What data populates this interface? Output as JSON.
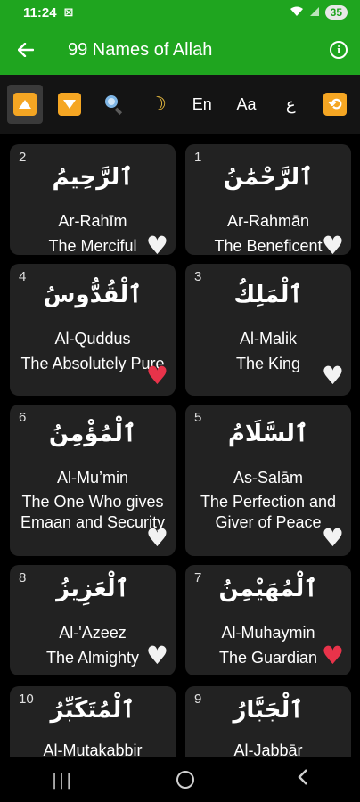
{
  "status": {
    "time": "11:24",
    "icons": "⊠",
    "battery": "35"
  },
  "appbar": {
    "title": "99 Names of Allah"
  },
  "toolbar": {
    "lang_label": "En",
    "font_label": "Aa",
    "arabic_label": "ع"
  },
  "cards": [
    {
      "number": "2",
      "arabic": "ٱلرَّحِيمُ",
      "translit": "Ar-Rahīm",
      "meaning": "The Merciful",
      "favorite": false
    },
    {
      "number": "1",
      "arabic": "ٱلرَّحْمَٰنُ",
      "translit": "Ar-Rahmān",
      "meaning": "The Beneficent",
      "favorite": false
    },
    {
      "number": "4",
      "arabic": "ٱلْقُدُّوسُ",
      "translit": "Al-Quddus",
      "meaning": "The Absolutely Pure",
      "favorite": true
    },
    {
      "number": "3",
      "arabic": "ٱلْمَلِكُ",
      "translit": "Al-Malik",
      "meaning": "The King",
      "favorite": false
    },
    {
      "number": "6",
      "arabic": "ٱلْمُؤْمِنُ",
      "translit": "Al-Mu’min",
      "meaning": "The One Who gives Emaan and Security",
      "favorite": false
    },
    {
      "number": "5",
      "arabic": "ٱلسَّلَامُ",
      "translit": "As-Salām",
      "meaning": "The Perfection and Giver of Peace",
      "favorite": false
    },
    {
      "number": "8",
      "arabic": "ٱلْعَزِيزُ",
      "translit": "Al-'Azeez",
      "meaning": "The Almighty",
      "favorite": false
    },
    {
      "number": "7",
      "arabic": "ٱلْمُهَيْمِنُ",
      "translit": "Al-Muhaymin",
      "meaning": "The Guardian",
      "favorite": true
    },
    {
      "number": "10",
      "arabic": "ٱلْمُتَكَبِّرُ",
      "translit": "Al-Mutakabbir",
      "meaning": "",
      "favorite": false
    },
    {
      "number": "9",
      "arabic": "ٱلْجَبَّارُ",
      "translit": "Al-Jabbār",
      "meaning": "",
      "favorite": false
    }
  ],
  "colors": {
    "appbar": "#1fa51f",
    "card": "#222222",
    "accent": "#f5a623",
    "heart_favorite": "#e8334a",
    "heart_default": "#f2f2f2"
  }
}
